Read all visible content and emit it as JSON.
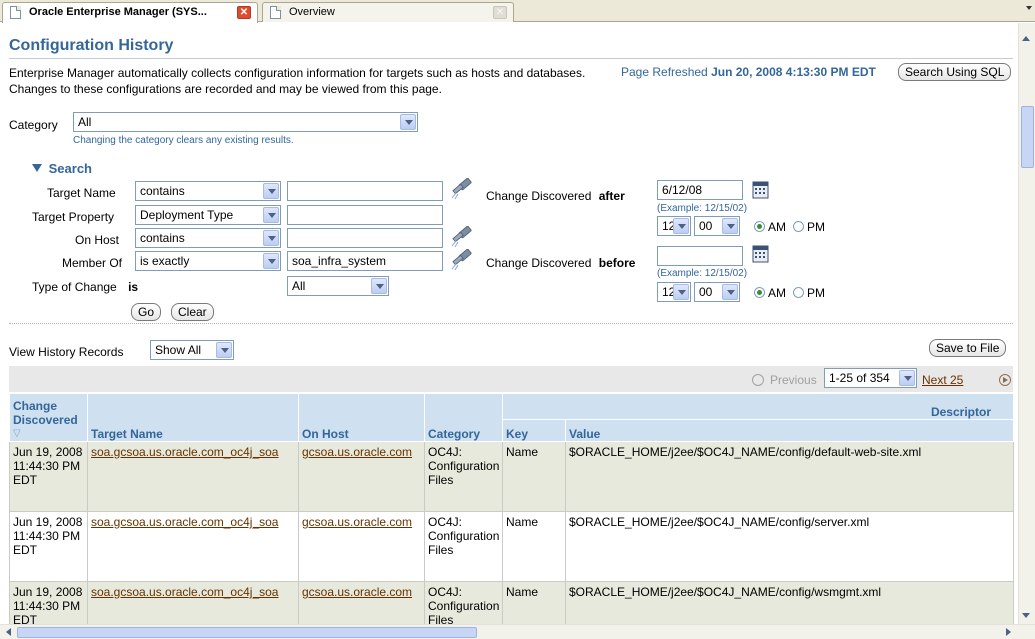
{
  "browser": {
    "tabs": [
      {
        "label": "Oracle Enterprise Manager (SYS...",
        "active": true
      },
      {
        "label": "Overview",
        "active": false
      }
    ]
  },
  "page": {
    "title": "Configuration History",
    "description": "Enterprise Manager automatically collects configuration information for targets such as hosts and databases. Changes to these configurations are recorded and may be viewed from this page.",
    "refreshed_label": "Page Refreshed",
    "refreshed_value": "Jun 20, 2008 4:13:30 PM EDT",
    "search_sql_button": "Search Using SQL"
  },
  "category": {
    "label": "Category",
    "value": "All",
    "hint": "Changing the category clears any existing results."
  },
  "search": {
    "heading": "Search",
    "target_name": {
      "label": "Target Name",
      "operator": "contains",
      "value": ""
    },
    "target_property": {
      "label": "Target Property",
      "operator": "Deployment Type",
      "value": ""
    },
    "on_host": {
      "label": "On Host",
      "operator": "contains",
      "value": ""
    },
    "member_of": {
      "label": "Member Of",
      "operator": "is exactly",
      "value": "soa_infra_system"
    },
    "type_of_change": {
      "label": "Type of Change",
      "operator": "is",
      "value": "All"
    },
    "go_button": "Go",
    "clear_button": "Clear",
    "after": {
      "label": "Change Discovered",
      "qualifier": "after",
      "date": "6/12/08",
      "example": "(Example: 12/15/02)",
      "hour": "12",
      "minute": "00",
      "am": "AM",
      "pm": "PM"
    },
    "before": {
      "label": "Change Discovered",
      "qualifier": "before",
      "date": "",
      "example": "(Example: 12/15/02)",
      "hour": "12",
      "minute": "00",
      "am": "AM",
      "pm": "PM"
    }
  },
  "history": {
    "view_label": "View History Records",
    "view_value": "Show All",
    "save_button": "Save to File",
    "previous_label": "Previous",
    "range_value": "1-25 of 354",
    "next_label": "Next 25"
  },
  "table": {
    "col_change_discovered": "Change Discovered",
    "col_target_name": "Target Name",
    "col_on_host": "On Host",
    "col_category": "Category",
    "col_descriptor": "Descriptor",
    "col_key": "Key",
    "col_value": "Value",
    "rows": [
      {
        "change": "Jun 19, 2008 11:44:30 PM EDT",
        "target": "soa.gcsoa.us.oracle.com_oc4j_soa",
        "host": "gcsoa.us.oracle.com",
        "category": "OC4J: Configuration Files",
        "key": "Name",
        "value": "$ORACLE_HOME/j2ee/$OC4J_NAME/config/default-web-site.xml"
      },
      {
        "change": "Jun 19, 2008 11:44:30 PM EDT",
        "target": "soa.gcsoa.us.oracle.com_oc4j_soa",
        "host": "gcsoa.us.oracle.com",
        "category": "OC4J: Configuration Files",
        "key": "Name",
        "value": "$ORACLE_HOME/j2ee/$OC4J_NAME/config/server.xml"
      },
      {
        "change": "Jun 19, 2008 11:44:30 PM EDT",
        "target": "soa.gcsoa.us.oracle.com_oc4j_soa",
        "host": "gcsoa.us.oracle.com",
        "category": "OC4J: Configuration Files",
        "key": "Name",
        "value": "$ORACLE_HOME/j2ee/$OC4J_NAME/config/wsmgmt.xml"
      }
    ]
  }
}
